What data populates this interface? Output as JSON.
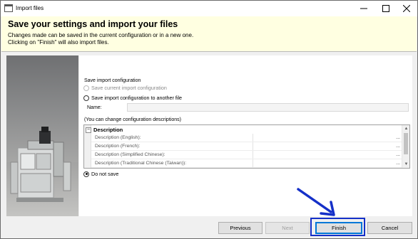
{
  "window": {
    "title": "Import files",
    "minimize_icon": "minimize-icon",
    "maximize_icon": "maximize-icon",
    "close_icon": "close-icon"
  },
  "header": {
    "title": "Save your settings and import your files",
    "line1": "Changes made can be saved in the current configuration or in a new one.",
    "line2": "Clicking on \"Finish\" will also import files."
  },
  "options": {
    "group_label": "Save import configuration",
    "save_current": "Save current import configuration",
    "save_another": "Save import configuration to another file",
    "name_label": "Name:",
    "name_value": "",
    "desc_hint": "(You can change configuration descriptions)",
    "do_not_save": "Do not save",
    "selected": "do_not_save"
  },
  "descriptions": {
    "category": "Description",
    "rows": [
      {
        "label": "Description (English):",
        "value": ""
      },
      {
        "label": "Description (French):",
        "value": ""
      },
      {
        "label": "Description (Simplified Chinese):",
        "value": ""
      },
      {
        "label": "Description (Traditional Chinese (Taiwan)):",
        "value": ""
      }
    ],
    "ellipsis": "..."
  },
  "buttons": {
    "previous": "Previous",
    "next": "Next",
    "finish": "Finish",
    "cancel": "Cancel"
  },
  "colors": {
    "header_bg": "#ffffe1",
    "annotation_blue": "#1530c8",
    "default_button_border": "#0078d7"
  }
}
